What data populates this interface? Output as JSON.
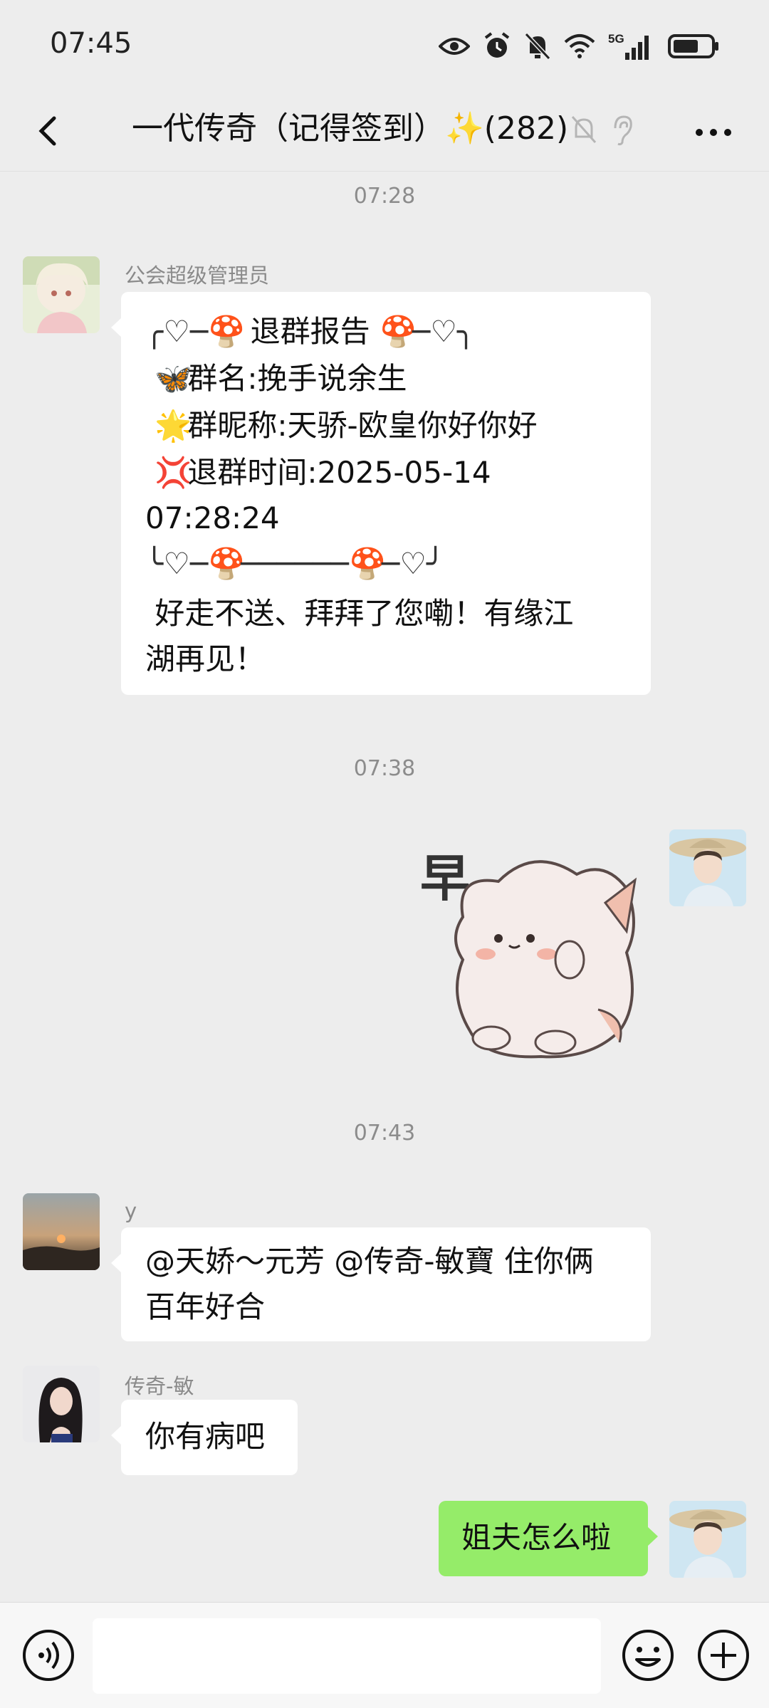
{
  "status_bar": {
    "time": "07:45",
    "network": "5G"
  },
  "nav": {
    "title": "一代传奇（记得签到）✨",
    "member_count": "(282)",
    "back_icon": "chevron-left-icon",
    "more_icon": "more-horizontal-icon"
  },
  "messages": [
    {
      "type": "timestamp",
      "text": "07:28"
    },
    {
      "type": "text",
      "side": "left",
      "sender": "公会超级管理员",
      "lines": [
        "退群报告",
        "群名:挽手说余生",
        "群昵称:天骄-欧皇你好你好",
        "退群时间:2025-05-14",
        "07:28:24",
        "好走不送、拜拜了您嘞！有缘江",
        "湖再见！"
      ]
    },
    {
      "type": "timestamp",
      "text": "07:38"
    },
    {
      "type": "sticker",
      "side": "right",
      "sticker_text": "早"
    },
    {
      "type": "timestamp",
      "text": "07:43"
    },
    {
      "type": "text",
      "side": "left",
      "sender": "y",
      "lines": [
        "@天娇～元芳 @传奇-敏寶  住你俩",
        "百年好合"
      ]
    },
    {
      "type": "text",
      "side": "left",
      "sender": "传奇-敏",
      "lines": [
        "你有病吧"
      ]
    },
    {
      "type": "text",
      "side": "right",
      "lines": [
        "姐夫怎么啦"
      ]
    }
  ],
  "input_bar": {
    "placeholder": ""
  },
  "colors": {
    "background": "#ededed",
    "my_bubble": "#95ec69",
    "other_bubble": "#ffffff"
  }
}
